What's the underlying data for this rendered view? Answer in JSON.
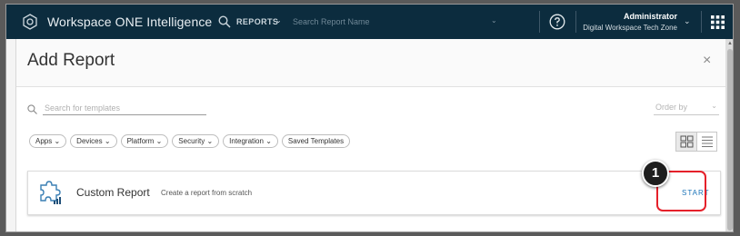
{
  "nav": {
    "brand": "Workspace ONE Intelligence",
    "reports_label": "REPORTS",
    "search_placeholder": "Search Report Name",
    "user_name": "Administrator",
    "user_org": "Digital Workspace Tech Zone"
  },
  "modal": {
    "title": "Add Report",
    "close_symbol": "×",
    "template_search_placeholder": "Search for templates",
    "order_by_label": "Order by",
    "filters": [
      "Apps",
      "Devices",
      "Platform",
      "Security",
      "Integration",
      "Saved Templates"
    ],
    "filters_with_dropdown": [
      true,
      true,
      true,
      true,
      true,
      false
    ],
    "card": {
      "title": "Custom Report",
      "description": "Create a report from scratch",
      "action_label": "START"
    }
  },
  "annotation": {
    "step_number": "1"
  },
  "colors": {
    "nav_bg": "#0c2c3e",
    "accent_link": "#1a73b8",
    "highlight": "#e5202a"
  },
  "icons": {
    "brand": "workspace-one-logo-icon",
    "search": "search-icon",
    "help": "help-circle-icon",
    "apps": "app-grid-icon",
    "close": "close-icon",
    "view_grid": "grid-view-icon",
    "view_list": "list-view-icon",
    "card": "puzzle-piece-icon"
  }
}
